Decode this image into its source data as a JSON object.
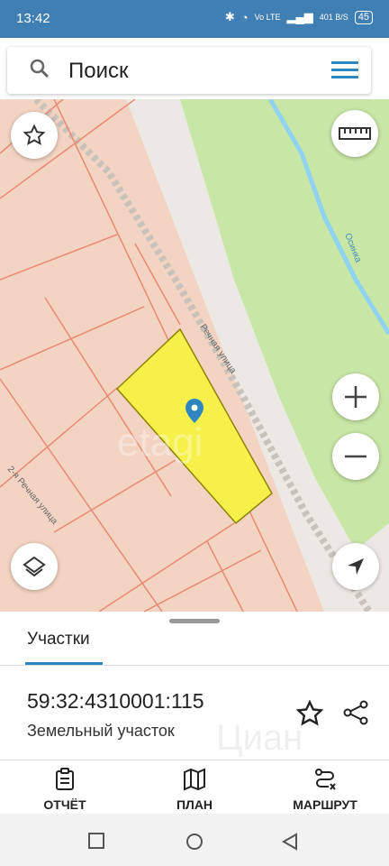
{
  "status": {
    "time": "13:42",
    "network": "Vo LTE",
    "speed": "401 B/S",
    "battery": "45"
  },
  "search": {
    "placeholder": "Поиск"
  },
  "map": {
    "street_main": "Речная улица",
    "street_second": "2-я Речная улица",
    "watermark": "etagi",
    "river_label": "Осинка"
  },
  "sheet": {
    "tab_label": "Участки",
    "parcel_id": "59:32:4310001:115",
    "parcel_type": "Земельный участок",
    "watermark": "Циан"
  },
  "bottom_nav": [
    {
      "label": "ОТЧЁТ",
      "icon": "report-icon"
    },
    {
      "label": "ПЛАН",
      "icon": "map-plan-icon"
    },
    {
      "label": "МАРШРУТ",
      "icon": "route-icon"
    }
  ],
  "colors": {
    "status_bar": "#3f7fb4",
    "accent": "#2e86c1",
    "parcel_fill": "#f6f04a",
    "land": "#f3d3c2",
    "park": "#c8e6a5"
  }
}
